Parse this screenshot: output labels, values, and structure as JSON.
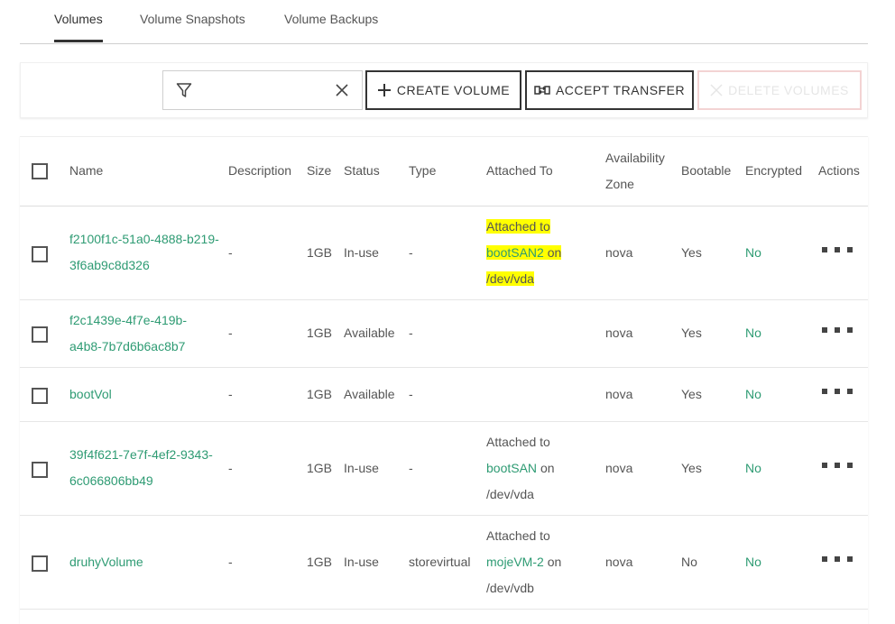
{
  "tabs": [
    {
      "label": "Volumes",
      "active": true
    },
    {
      "label": "Volume Snapshots",
      "active": false
    },
    {
      "label": "Volume Backups",
      "active": false
    }
  ],
  "toolbar": {
    "filter_value": "",
    "create_label": "CREATE VOLUME",
    "accept_label": "ACCEPT TRANSFER",
    "delete_label": "DELETE VOLUMES"
  },
  "columns": {
    "name": "Name",
    "description": "Description",
    "size": "Size",
    "status": "Status",
    "type": "Type",
    "attached_to": "Attached To",
    "az_line1": "Availability",
    "az_line2": "Zone",
    "bootable": "Bootable",
    "encrypted": "Encrypted",
    "actions": "Actions"
  },
  "rows": [
    {
      "name_line1": "f2100f1c-51a0-4888-b219-",
      "name_line2": "3f6ab9c8d326",
      "description": "-",
      "size": "1GB",
      "status": "In-use",
      "type": "-",
      "attached_prefix": "Attached to",
      "attached_server": "bootSAN2",
      "attached_on": "on",
      "attached_device": "/dev/vda",
      "az": "nova",
      "bootable": "Yes",
      "encrypted": "No"
    },
    {
      "name_line1": "f2c1439e-4f7e-419b-",
      "name_line2": "a4b8-7b7d6b6ac8b7",
      "description": "-",
      "size": "1GB",
      "status": "Available",
      "type": "-",
      "az": "nova",
      "bootable": "Yes",
      "encrypted": "No"
    },
    {
      "name_line1": "bootVol",
      "description": "-",
      "size": "1GB",
      "status": "Available",
      "type": "-",
      "az": "nova",
      "bootable": "Yes",
      "encrypted": "No"
    },
    {
      "name_line1": "39f4f621-7e7f-4ef2-9343-",
      "name_line2": "6c066806bb49",
      "description": "-",
      "size": "1GB",
      "status": "In-use",
      "type": "-",
      "attached_prefix": "Attached to",
      "attached_server": "bootSAN",
      "attached_on": "on",
      "attached_device": "/dev/vda",
      "az": "nova",
      "bootable": "Yes",
      "encrypted": "No"
    },
    {
      "name_line1": "druhyVolume",
      "description": "-",
      "size": "1GB",
      "status": "In-use",
      "type": "storevirtual",
      "attached_prefix": "Attached to",
      "attached_server": "mojeVM-2",
      "attached_on": "on",
      "attached_device": "/dev/vdb",
      "az": "nova",
      "bootable": "No",
      "encrypted": "No"
    }
  ],
  "colors": {
    "link": "#2e9b73",
    "highlight": "#ffff00",
    "delete_border": "#f3d3d3"
  }
}
